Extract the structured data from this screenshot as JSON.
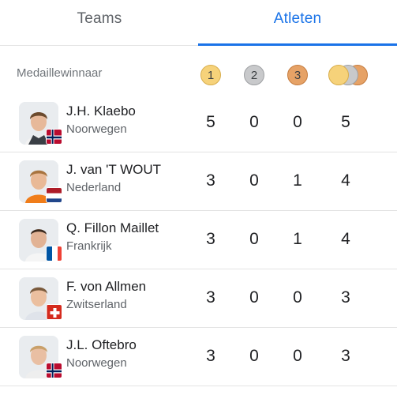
{
  "tabs": [
    {
      "label": "Teams",
      "active": false
    },
    {
      "label": "Atleten",
      "active": true
    }
  ],
  "accent_color": "#1a73e8",
  "table": {
    "column_label": "Medaillewinnaar",
    "medals": {
      "gold": "1",
      "silver": "2",
      "bronze": "3"
    },
    "rows": [
      {
        "name": "J.H. Klaebo",
        "country": "Noorwegen",
        "flag": "norway-flag-icon",
        "gold": "5",
        "silver": "0",
        "bronze": "0",
        "total": "5"
      },
      {
        "name": "J. van 'T WOUT",
        "country": "Nederland",
        "flag": "netherlands-flag-icon",
        "gold": "3",
        "silver": "0",
        "bronze": "1",
        "total": "4"
      },
      {
        "name": "Q. Fillon Maillet",
        "country": "Frankrijk",
        "flag": "france-flag-icon",
        "gold": "3",
        "silver": "0",
        "bronze": "1",
        "total": "4"
      },
      {
        "name": "F. von Allmen",
        "country": "Zwitserland",
        "flag": "switzerland-flag-icon",
        "gold": "3",
        "silver": "0",
        "bronze": "0",
        "total": "3"
      },
      {
        "name": "J.L. Oftebro",
        "country": "Noorwegen",
        "flag": "norway-flag-icon",
        "gold": "3",
        "silver": "0",
        "bronze": "0",
        "total": "3"
      }
    ]
  }
}
